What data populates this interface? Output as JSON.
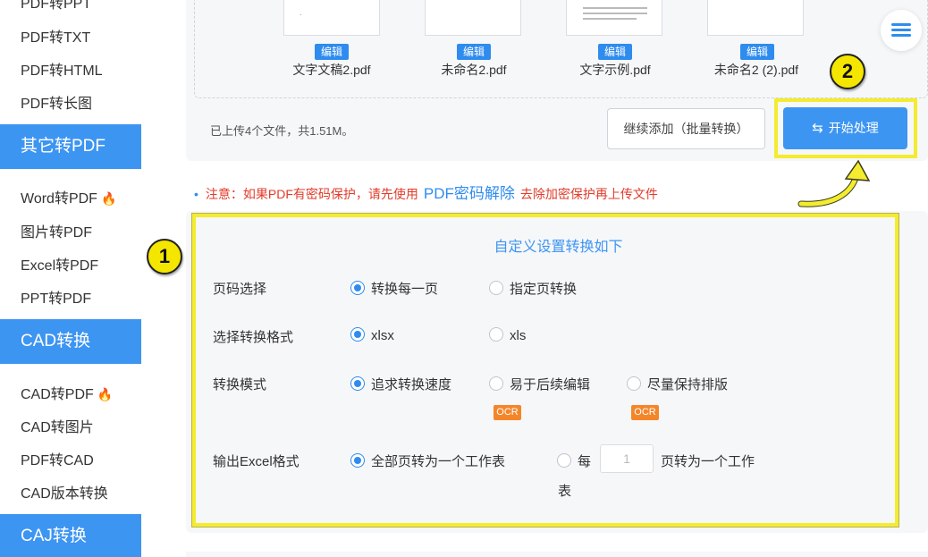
{
  "sidebar": {
    "items": [
      {
        "label": "PDF转PPT"
      },
      {
        "label": "PDF转TXT"
      },
      {
        "label": "PDF转HTML"
      },
      {
        "label": "PDF转长图"
      }
    ],
    "sections": [
      {
        "title": "其它转PDF",
        "items": [
          {
            "label": "Word转PDF",
            "hot": true
          },
          {
            "label": "图片转PDF"
          },
          {
            "label": "Excel转PDF"
          },
          {
            "label": "PPT转PDF"
          }
        ]
      },
      {
        "title": "CAD转换",
        "items": [
          {
            "label": "CAD转PDF",
            "hot": true
          },
          {
            "label": "CAD转图片"
          },
          {
            "label": "PDF转CAD"
          },
          {
            "label": "CAD版本转换"
          }
        ]
      },
      {
        "title": "CAJ转换"
      }
    ],
    "hot_icon": "flame-icon"
  },
  "files": [
    {
      "name": "文字文稿2.pdf",
      "edit_label": "编辑"
    },
    {
      "name": "未命名2.pdf",
      "edit_label": "编辑"
    },
    {
      "name": "文字示例.pdf",
      "edit_label": "编辑"
    },
    {
      "name": "未命名2 (2).pdf",
      "edit_label": "编辑"
    }
  ],
  "upload": {
    "info": "已上传4个文件，共1.51M。",
    "add_button": "继续添加（批量转换）",
    "start_button": "开始处理"
  },
  "annotations": {
    "one": "1",
    "two": "2"
  },
  "notice": {
    "bullet": "•",
    "prefix": "注意：如果PDF有密码保护，请先使用",
    "link": "PDF密码解除",
    "suffix": "去除加密保护再上传文件"
  },
  "settings": {
    "title": "自定义设置转换如下",
    "page_select": {
      "label": "页码选择",
      "options": [
        "转换每一页",
        "指定页转换"
      ],
      "selected": 0
    },
    "format": {
      "label": "选择转换格式",
      "options": [
        "xlsx",
        "xls"
      ],
      "selected": 0
    },
    "mode": {
      "label": "转换模式",
      "options": [
        "追求转换速度",
        "易于后续编辑",
        "尽量保持排版"
      ],
      "selected": 0,
      "ocr_badge": "OCR"
    },
    "output": {
      "label": "输出Excel格式",
      "option_all": "全部页转为一个工作表",
      "option_each_prefix": "每",
      "each_value": "1",
      "option_each_suffix_1": "页转为一个工作",
      "option_each_suffix_2": "表",
      "selected": 0
    }
  },
  "colors": {
    "accent": "#3d95f2",
    "highlight": "#f3ec2f",
    "warning": "#e23b2a",
    "ocr": "#f4862a"
  }
}
